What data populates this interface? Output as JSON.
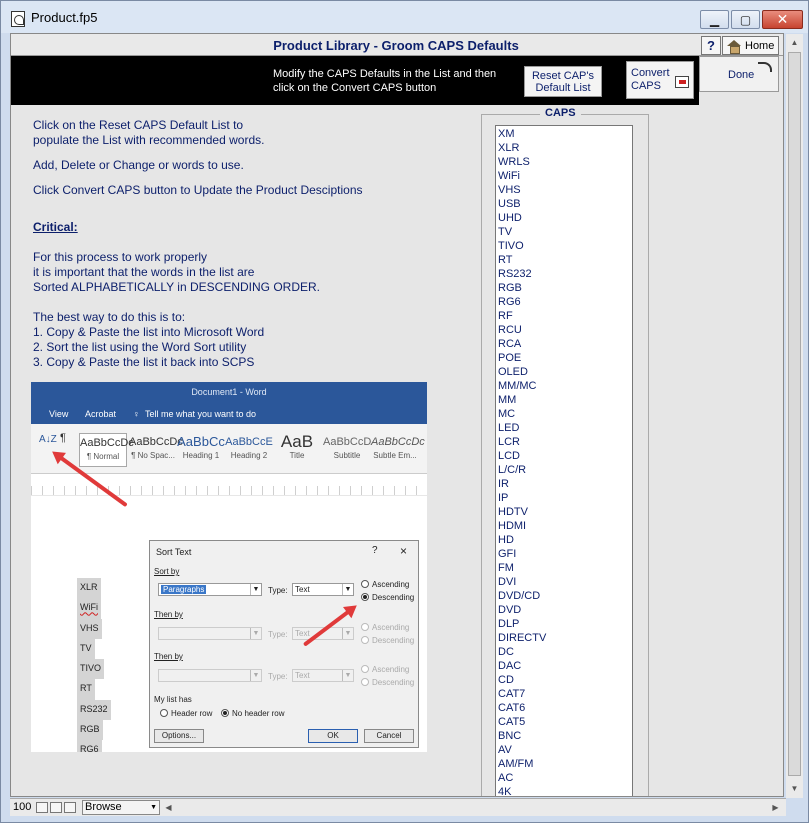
{
  "window": {
    "title": "Product.fp5"
  },
  "header": {
    "title": "Product Library - Groom CAPS Defaults",
    "help_label": "?",
    "home_label": "Home"
  },
  "toolbar": {
    "message_line1": "Modify the CAPS Defaults in the List and then",
    "message_line2": "click on the Convert CAPS button",
    "reset_label_line1": "Reset CAP's",
    "reset_label_line2": "Default List",
    "convert_label_line1": "Convert",
    "convert_label_line2": "CAPS",
    "done_label": "Done"
  },
  "instructions": {
    "p1_line1": "Click on the Reset CAPS Default List to",
    "p1_line2": "populate the List with recommended words.",
    "p2": "Add, Delete or Change or words to use.",
    "p3": "Click Convert CAPS button to Update the Product Desciptions",
    "critical": "Critical:",
    "p4_line1": "For this process to work properly",
    "p4_line2": "it is important that the words in the list are",
    "p4_line3": "Sorted ALPHABETICALLY in DESCENDING ORDER.",
    "p5_line1": "The best way to do this is to:",
    "p5_line2": "1. Copy & Paste the list into Microsoft Word",
    "p5_line3": "2. Sort the list using the Word Sort utility",
    "p5_line4": "3. Copy & Paste the list it back into SCPS"
  },
  "word_image": {
    "title": "Document1 - Word",
    "menu": [
      "View",
      "Acrobat",
      "Tell me what you want to do"
    ],
    "styles": [
      {
        "sample": "AaBbCcDc",
        "name": "¶ Normal"
      },
      {
        "sample": "AaBbCcDc",
        "name": "¶ No Spac..."
      },
      {
        "sample": "AaBbCc",
        "name": "Heading 1"
      },
      {
        "sample": "AaBbCcE",
        "name": "Heading 2"
      },
      {
        "sample": "AaB",
        "name": "Title"
      },
      {
        "sample": "AaBbCcD",
        "name": "Subtitle"
      },
      {
        "sample": "AaBbCcDc",
        "name": "Subtle Em..."
      }
    ],
    "doc_words": [
      "XLR",
      "WiFi",
      "VHS",
      "TV",
      "TIVO",
      "RT",
      "RS232",
      "RGB",
      "RG6"
    ],
    "dialog": {
      "title": "Sort Text",
      "help": "?",
      "sort_by": "Sort by",
      "sort_by_value": "Paragraphs",
      "type_label": "Type:",
      "type_value": "Text",
      "ascending": "Ascending",
      "descending": "Descending",
      "then_by": "Then by",
      "list_has": "My list has",
      "header_row": "Header row",
      "no_header_row": "No header row",
      "options": "Options...",
      "ok": "OK",
      "cancel": "Cancel"
    }
  },
  "caps": {
    "label": "CAPS",
    "items": [
      "XM",
      "XLR",
      "WRLS",
      "WiFi",
      "VHS",
      "USB",
      "UHD",
      "TV",
      "TIVO",
      "RT",
      "RS232",
      "RGB",
      "RG6",
      "RF",
      "RCU",
      "RCA",
      "POE",
      "OLED",
      "MM/MC",
      "MM",
      "MC",
      "LED",
      "LCR",
      "LCD",
      "L/C/R",
      "IR",
      "IP",
      "HDTV",
      "HDMI",
      "HD",
      "GFI",
      "FM",
      "DVI",
      "DVD/CD",
      "DVD",
      "DLP",
      "DIRECTV",
      "DC",
      "DAC",
      "CD",
      "CAT7",
      "CAT6",
      "CAT5",
      "BNC",
      "AV",
      "AM/FM",
      "AC",
      "4K"
    ]
  },
  "status": {
    "zoom": "100",
    "mode": "Browse"
  }
}
